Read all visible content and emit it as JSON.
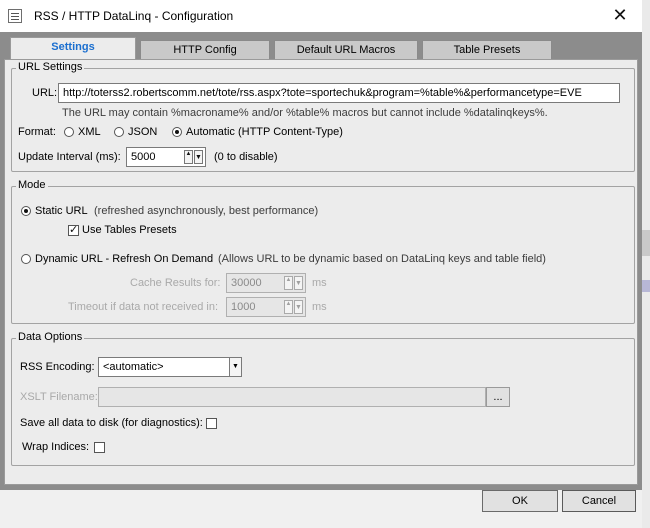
{
  "window": {
    "title": "RSS / HTTP DataLinq - Configuration",
    "close_glyph": "✕",
    "app_icon": "window-icon"
  },
  "tabs": [
    {
      "label": "Settings",
      "active": true
    },
    {
      "label": "HTTP Config",
      "active": false
    },
    {
      "label": "Default URL Macros",
      "active": false
    },
    {
      "label": "Table Presets",
      "active": false
    }
  ],
  "url_settings": {
    "legend": "URL Settings",
    "url_label": "URL:",
    "url_value": "http://toterss2.robertscomm.net/tote/rss.aspx?tote=sportechuk&program=%table%&performancetype=EVE",
    "url_help": "The URL may contain %macroname% and/or %table% macros but cannot include %datalinqkeys%.",
    "format_label": "Format:",
    "format_options": [
      "XML",
      "JSON",
      "Automatic (HTTP Content-Type)"
    ],
    "format_selected": "Automatic (HTTP Content-Type)",
    "update_interval_label": "Update Interval (ms):",
    "update_interval_value": "5000",
    "update_interval_hint": "(0 to disable)"
  },
  "mode": {
    "legend": "Mode",
    "static_label": "Static URL",
    "static_hint": "(refreshed asynchronously, best performance)",
    "use_presets_label": "Use Tables Presets",
    "use_presets_checked": true,
    "dynamic_label": "Dynamic URL - Refresh On Demand",
    "dynamic_hint": "(Allows URL to be dynamic based on DataLinq keys and table field)",
    "selected": "static",
    "cache_label": "Cache Results for:",
    "cache_value": "30000",
    "cache_unit": "ms",
    "timeout_label": "Timeout if data not received in:",
    "timeout_value": "1000",
    "timeout_unit": "ms"
  },
  "data_options": {
    "legend": "Data Options",
    "rss_encoding_label": "RSS Encoding:",
    "rss_encoding_value": "<automatic>",
    "xslt_label": "XSLT Filename:",
    "xslt_value": "",
    "browse_label": "...",
    "save_disk_label": "Save all data to disk (for diagnostics):",
    "save_disk_checked": false,
    "wrap_indices_label": "Wrap Indices:",
    "wrap_indices_checked": false
  },
  "buttons": {
    "ok": "OK",
    "cancel": "Cancel"
  }
}
